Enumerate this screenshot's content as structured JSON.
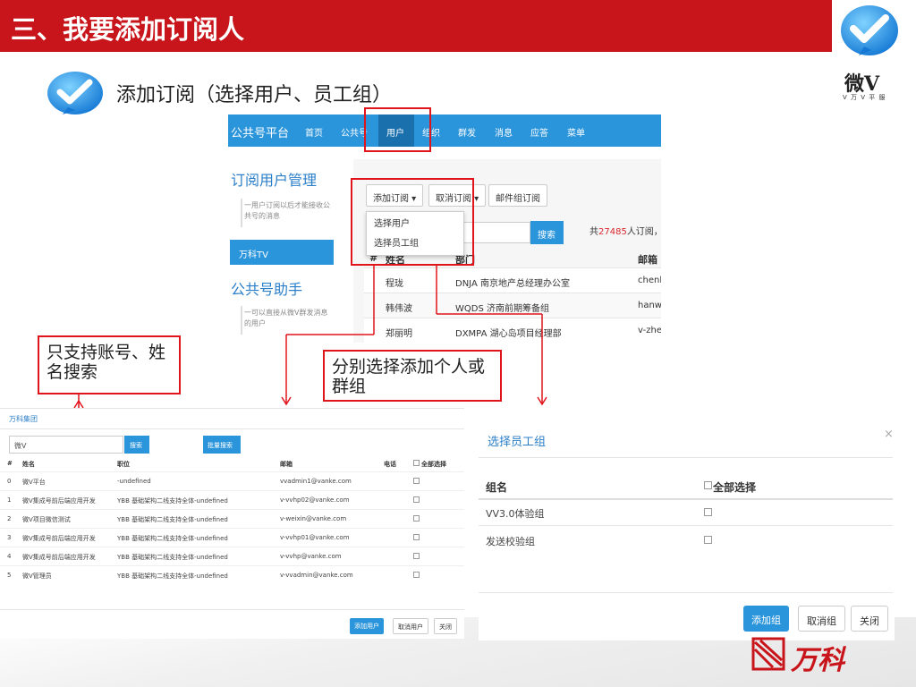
{
  "slide": {
    "title": "三、我要添加订阅人",
    "subtitle": "添加订阅（选择用户、员工组）",
    "logo_main": "微V",
    "logo_sub": "V 万 V 平 服",
    "brand_name": "万科",
    "colors": {
      "title_bar": "#c8141b",
      "highlight": "#e0141b",
      "nav_blue": "#2b95db"
    }
  },
  "callouts": {
    "search_only": "只支持账号、姓名搜索",
    "select_individual": "分别选择添加个人或群组"
  },
  "shot1": {
    "nav": {
      "brand": "公共号平台",
      "items": [
        "首页",
        "公共号",
        "用户",
        "组织",
        "群发",
        "消息",
        "应答",
        "菜单"
      ],
      "active": "用户"
    },
    "sidebar": {
      "heading1": "订阅用户管理",
      "desc1": "一用户订阅以后才能接收公共号的消息",
      "active_item": "万科TV",
      "heading2": "公共号助手",
      "desc2": "一可以直接从微V群发消息的用户"
    },
    "toolbar": {
      "add": "添加订阅",
      "cancel": "取消订阅",
      "mail": "邮件组订阅"
    },
    "dropdown": [
      "选择用户",
      "选择员工组"
    ],
    "search_button": "搜索",
    "count_prefix": "共",
    "count_value": "27485",
    "count_suffix": "人订阅，有",
    "columns": [
      "#",
      "姓名",
      "部门",
      "邮箱"
    ],
    "rows": [
      {
        "name": "程珑",
        "dept": "DNJA 南京地产总经理办公室",
        "email": "chenl"
      },
      {
        "name": "韩伟波",
        "dept": "WQDS 济南前期筹备组",
        "email": "hanwb"
      },
      {
        "name": "郑丽明",
        "dept": "DXMPA 湖心岛项目经理部",
        "email": "v-zhe"
      }
    ]
  },
  "shot2": {
    "org": "万科集团",
    "search_value": "微V",
    "search_button": "搜索",
    "batch_button": "批量搜索",
    "columns": [
      "#",
      "姓名",
      "职位",
      "邮箱",
      "电话",
      "全部选择"
    ],
    "rows": [
      {
        "idx": "0",
        "name": "微V平台",
        "title": "-undefined",
        "email": "vvadmin1@vanke.com"
      },
      {
        "idx": "1",
        "name": "微V集成号前后端应用开发",
        "title": "YBB 基础架构二线支持全体-undefined",
        "email": "v-vvhp02@vanke.com"
      },
      {
        "idx": "2",
        "name": "微V项目微信测试",
        "title": "YBB 基础架构二线支持全体-undefined",
        "email": "v-weixin@vanke.com"
      },
      {
        "idx": "3",
        "name": "微V集成号前后端应用开发",
        "title": "YBB 基础架构二线支持全体-undefined",
        "email": "v-vvhp01@vanke.com"
      },
      {
        "idx": "4",
        "name": "微V集成号前后端应用开发",
        "title": "YBB 基础架构二线支持全体-undefined",
        "email": "v-vvhp@vanke.com"
      },
      {
        "idx": "5",
        "name": "微V管理员",
        "title": "YBB 基础架构二线支持全体-undefined",
        "email": "v-vvadmin@vanke.com"
      }
    ],
    "footer": {
      "add": "添加用户",
      "cancel": "取消用户",
      "close": "关闭"
    }
  },
  "shot3": {
    "title": "选择员工组",
    "close": "×",
    "col_group": "组名",
    "col_all": "全部选择",
    "rows": [
      "VV3.0体验组",
      "发送校验组"
    ],
    "footer": {
      "add": "添加组",
      "cancel": "取消组",
      "close": "关闭"
    }
  }
}
